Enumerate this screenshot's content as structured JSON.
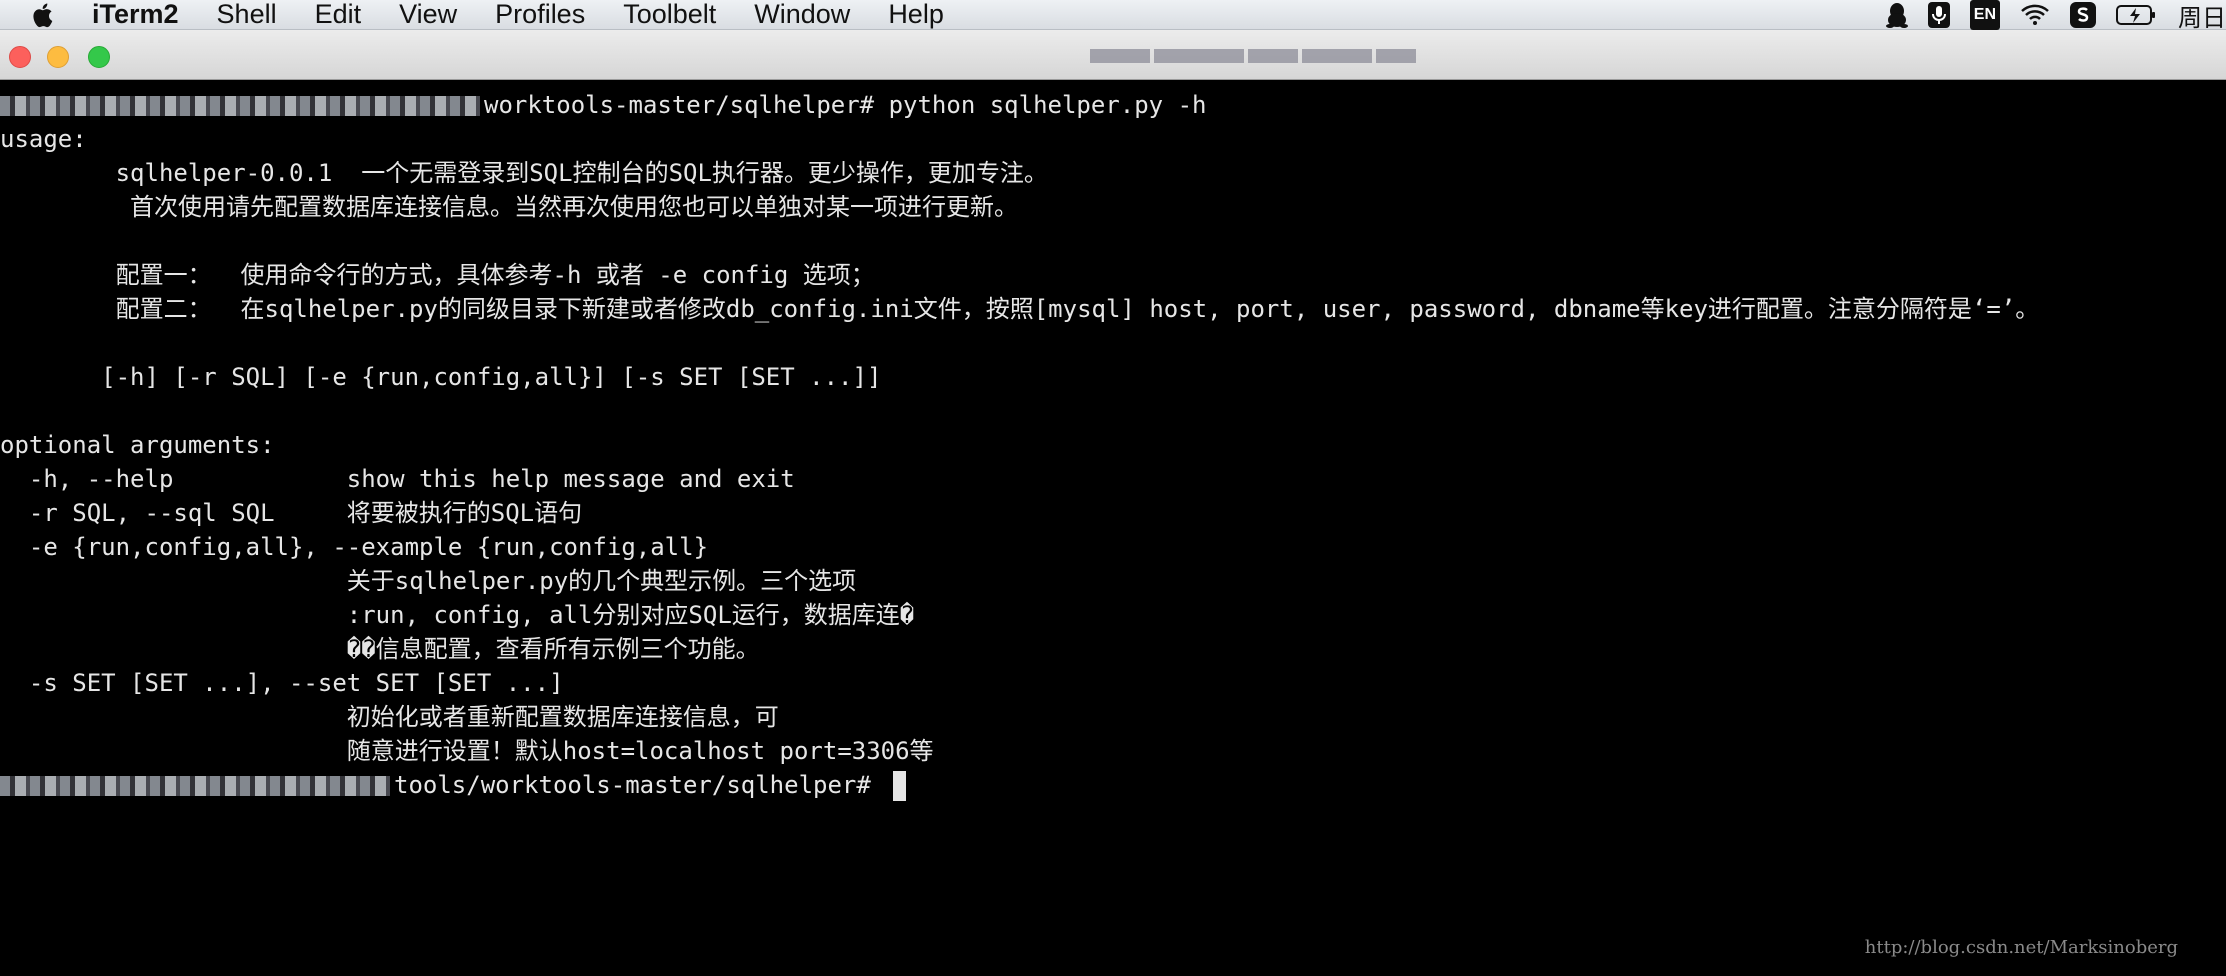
{
  "menubar": {
    "app_name": "iTerm2",
    "items": [
      "Shell",
      "Edit",
      "View",
      "Profiles",
      "Toolbelt",
      "Window",
      "Help"
    ],
    "status": {
      "input_source": "EN",
      "clock": "周日"
    }
  },
  "terminal": {
    "lines": [
      "worktools-master/sqlhelper# python sqlhelper.py -h",
      "usage:",
      "        sqlhelper-0.0.1  一个无需登录到SQL控制台的SQL执行器。更少操作，更加专注。",
      "         首次使用请先配置数据库连接信息。当然再次使用您也可以单独对某一项进行更新。",
      "",
      "        配置一：  使用命令行的方式，具体参考-h 或者 -e config 选项；",
      "        配置二：  在sqlhelper.py的同级目录下新建或者修改db_config.ini文件，按照[mysql] host, port, user, password, dbname等key进行配置。注意分隔符是‘=’。",
      "",
      "       [-h] [-r SQL] [-e {run,config,all}] [-s SET [SET ...]]",
      "",
      "optional arguments:",
      "  -h, --help            show this help message and exit",
      "  -r SQL, --sql SQL     将要被执行的SQL语句",
      "  -e {run,config,all}, --example {run,config,all}",
      "                        关于sqlhelper.py的几个典型示例。三个选项",
      "                        :run, config, all分别对应SQL运行，数据库连�",
      "                        ��信息配置，查看所有示例三个功能。",
      "  -s SET [SET ...], --set SET [SET ...]",
      "                        初始化或者重新配置数据库连接信息，可",
      "                        随意进行设置！默认host=localhost port=3306等",
      "tools/worktools-master/sqlhelper# "
    ]
  },
  "watermark": "http://blog.csdn.net/Marksinoberg"
}
